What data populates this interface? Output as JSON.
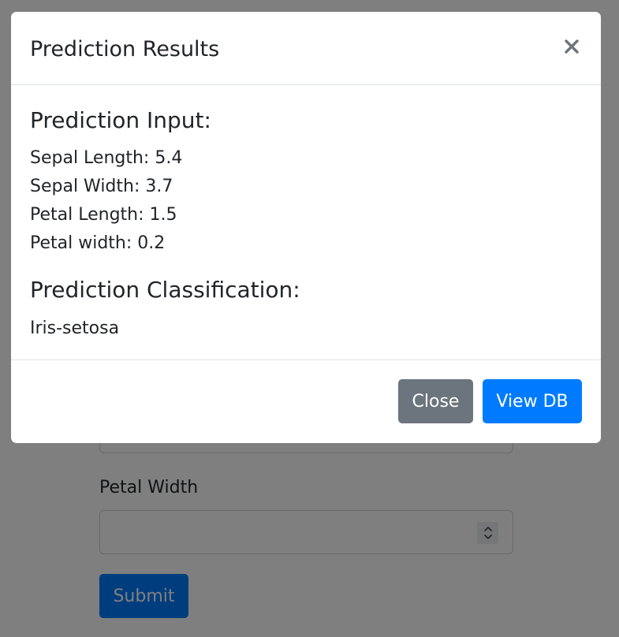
{
  "modal": {
    "title": "Prediction Results",
    "close_icon": "close-icon",
    "input_heading": "Prediction Input:",
    "inputs": [
      {
        "label": "Sepal Length: ",
        "value": "5.4"
      },
      {
        "label": "Sepal Width: ",
        "value": "3.7"
      },
      {
        "label": "Petal Length: ",
        "value": "1.5"
      },
      {
        "label": "Petal width: ",
        "value": "0.2"
      }
    ],
    "classification_heading": "Prediction Classification:",
    "classification": "Iris-setosa",
    "buttons": {
      "close_label": "Close",
      "view_db_label": "View DB"
    }
  },
  "background_form": {
    "petal_width_label": "Petal Width",
    "petal_width_value": "",
    "submit_label": "Submit"
  },
  "colors": {
    "primary": "#007bff",
    "secondary": "#6c757d",
    "backdrop": "rgba(0,0,0,0.5)"
  }
}
